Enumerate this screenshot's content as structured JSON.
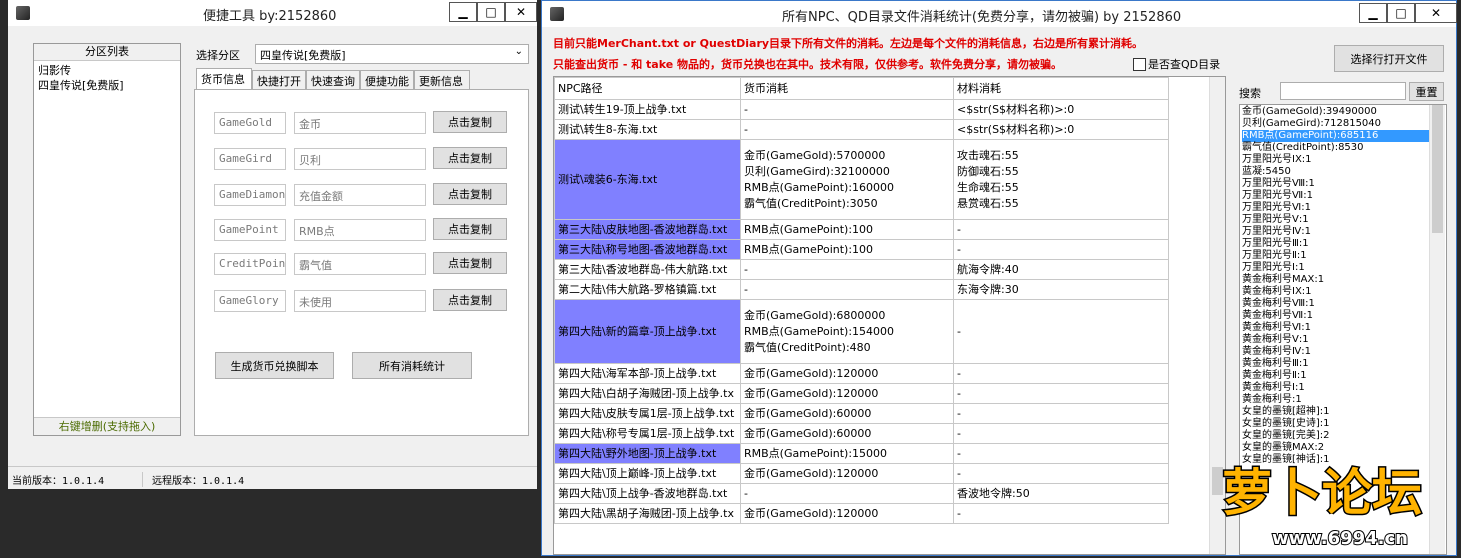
{
  "left": {
    "title": "便捷工具  by:2152860",
    "buttons": {
      "min": "▁",
      "max": "□",
      "close": "✕"
    },
    "partition_header": "分区列表",
    "partitions": [
      "归影传",
      "四皇传说[免费版]"
    ],
    "partition_footer": "右键增删(支持拖入)",
    "select_label": "选择分区",
    "select_value": "四皇传说[免费版]",
    "tabs": [
      "货币信息",
      "快捷打开",
      "快速查询",
      "便捷功能",
      "更新信息"
    ],
    "currencies": [
      {
        "key": "GameGold",
        "name": "金币",
        "btn": "点击复制"
      },
      {
        "key": "GameGird",
        "name": "贝利",
        "btn": "点击复制"
      },
      {
        "key": "GameDiamond",
        "name": "充值金额",
        "btn": "点击复制"
      },
      {
        "key": "GamePoint",
        "name": "RMB点",
        "btn": "点击复制"
      },
      {
        "key": "CreditPoint",
        "name": "霸气值",
        "btn": "点击复制"
      },
      {
        "key": "GameGlory",
        "name": "未使用",
        "btn": "点击复制"
      }
    ],
    "gen_script": "生成货币兑换脚本",
    "all_stats": "所有消耗统计",
    "current_version": "当前版本：1.0.1.4",
    "remote_version": "远程版本：1.0.1.4"
  },
  "right": {
    "title": "所有NPC、QD目录文件消耗统计(免费分享，请勿被骗)    by 2152860",
    "notice1": "目前只能MerChant.txt or QuestDiary目录下所有文件的消耗。左边是每个文件的消耗信息，右边是所有累计消耗。",
    "notice2": "只能查出货币 - 和 take 物品的，货币兑换也在其中。技术有限，仅供参考。软件免费分享，请勿被骗。",
    "checkbox_label": "是否查QD目录",
    "open_file_btn": "选择行打开文件",
    "search_label": "搜索",
    "reset_btn": "重置",
    "columns": [
      "NPC路径",
      "货币消耗",
      "材料消耗"
    ],
    "rows": [
      {
        "path": "测试\\转生19-顶上战争.txt",
        "cur": [
          "-"
        ],
        "mat": [
          "<$str(S$材料名称)>:0"
        ],
        "sel": false
      },
      {
        "path": "测试\\转生8-东海.txt",
        "cur": [
          "-"
        ],
        "mat": [
          "<$str(S$材料名称)>:0"
        ],
        "sel": false
      },
      {
        "path": "测试\\魂装6-东海.txt",
        "cur": [
          "金币(GameGold):5700000",
          "贝利(GameGird):32100000",
          "RMB点(GamePoint):160000",
          "霸气值(CreditPoint):3050"
        ],
        "mat": [
          "攻击魂石:55",
          "防御魂石:55",
          "生命魂石:55",
          "悬赏魂石:55"
        ],
        "sel": true
      },
      {
        "path": "第三大陆\\皮肤地图-香波地群岛.txt",
        "cur": [
          "RMB点(GamePoint):100"
        ],
        "mat": [
          "-"
        ],
        "sel": true
      },
      {
        "path": "第三大陆\\称号地图-香波地群岛.txt",
        "cur": [
          "RMB点(GamePoint):100"
        ],
        "mat": [
          "-"
        ],
        "sel": true
      },
      {
        "path": "第三大陆\\香波地群岛-伟大航路.txt",
        "cur": [
          "-"
        ],
        "mat": [
          "航海令牌:40"
        ],
        "sel": false
      },
      {
        "path": "第二大陆\\伟大航路-罗格镇篇.txt",
        "cur": [
          "-"
        ],
        "mat": [
          "东海令牌:30"
        ],
        "sel": false
      },
      {
        "path": "第四大陆\\新的篇章-顶上战争.txt",
        "cur": [
          "金币(GameGold):6800000",
          "RMB点(GamePoint):154000",
          "霸气值(CreditPoint):480"
        ],
        "mat": [
          "-"
        ],
        "sel": true
      },
      {
        "path": "第四大陆\\海军本部-顶上战争.txt",
        "cur": [
          "金币(GameGold):120000"
        ],
        "mat": [
          "-"
        ],
        "sel": false
      },
      {
        "path": "第四大陆\\白胡子海贼团-顶上战争.tx",
        "cur": [
          "金币(GameGold):120000"
        ],
        "mat": [
          "-"
        ],
        "sel": false
      },
      {
        "path": "第四大陆\\皮肤专属1层-顶上战争.txt",
        "cur": [
          "金币(GameGold):60000"
        ],
        "mat": [
          "-"
        ],
        "sel": false
      },
      {
        "path": "第四大陆\\称号专属1层-顶上战争.txt",
        "cur": [
          "金币(GameGold):60000"
        ],
        "mat": [
          "-"
        ],
        "sel": false
      },
      {
        "path": "第四大陆\\野外地图-顶上战争.txt",
        "cur": [
          "RMB点(GamePoint):15000"
        ],
        "mat": [
          "-"
        ],
        "sel": true
      },
      {
        "path": "第四大陆\\顶上巅峰-顶上战争.txt",
        "cur": [
          "金币(GameGold):120000"
        ],
        "mat": [
          "-"
        ],
        "sel": false
      },
      {
        "path": "第四大陆\\顶上战争-香波地群岛.txt",
        "cur": [
          "-"
        ],
        "mat": [
          "香波地令牌:50"
        ],
        "sel": false
      },
      {
        "path": "第四大陆\\黑胡子海贼团-顶上战争.tx",
        "cur": [
          "金币(GameGold):120000"
        ],
        "mat": [
          "-"
        ],
        "sel": false
      }
    ],
    "summary": [
      "金币(GameGold):39490000",
      "贝利(GameGird):712815040",
      "RMB点(GamePoint):685116",
      "霸气值(CreditPoint):8530",
      "万里阳光号IX:1",
      "蓝凝:5450",
      "万里阳光号Ⅷ:1",
      "万里阳光号Ⅶ:1",
      "万里阳光号Ⅵ:1",
      "万里阳光号Ⅴ:1",
      "万里阳光号Ⅳ:1",
      "万里阳光号Ⅲ:1",
      "万里阳光号Ⅱ:1",
      "万里阳光号Ⅰ:1",
      "黄金梅利号MAX:1",
      "黄金梅利号IX:1",
      "黄金梅利号Ⅷ:1",
      "黄金梅利号Ⅶ:1",
      "黄金梅利号Ⅵ:1",
      "黄金梅利号Ⅴ:1",
      "黄金梅利号Ⅳ:1",
      "黄金梅利号Ⅲ:1",
      "黄金梅利号Ⅱ:1",
      "黄金梅利号Ⅰ:1",
      "黄金梅利号:1",
      "女皇的墨镜[超神]:1",
      "女皇的墨镜[史诗]:1",
      "女皇的墨镜[完美]:2",
      "女皇的墨镜MAX:2",
      "女皇的墨镜[神话]:1"
    ],
    "summary_selected": 2
  },
  "watermark": {
    "brand": "萝卜论坛",
    "url": "www.6994.cn"
  }
}
